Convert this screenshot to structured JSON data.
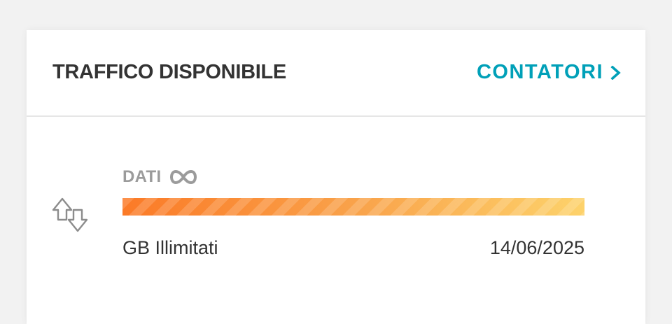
{
  "header": {
    "title": "TRAFFICO DISPONIBILE",
    "link_label": "CONTATORI",
    "link_icon": "chevron-right-icon",
    "accent_color": "#00a0b8"
  },
  "data_item": {
    "label": "DATI",
    "label_icon": "infinity-icon",
    "row_icon": "transfer-arrows-icon",
    "amount": "GB Illimitati",
    "date": "14/06/2025",
    "progress_fraction": 1.0,
    "bar_colors": [
      "#fb7a27",
      "#fdd26b"
    ]
  }
}
